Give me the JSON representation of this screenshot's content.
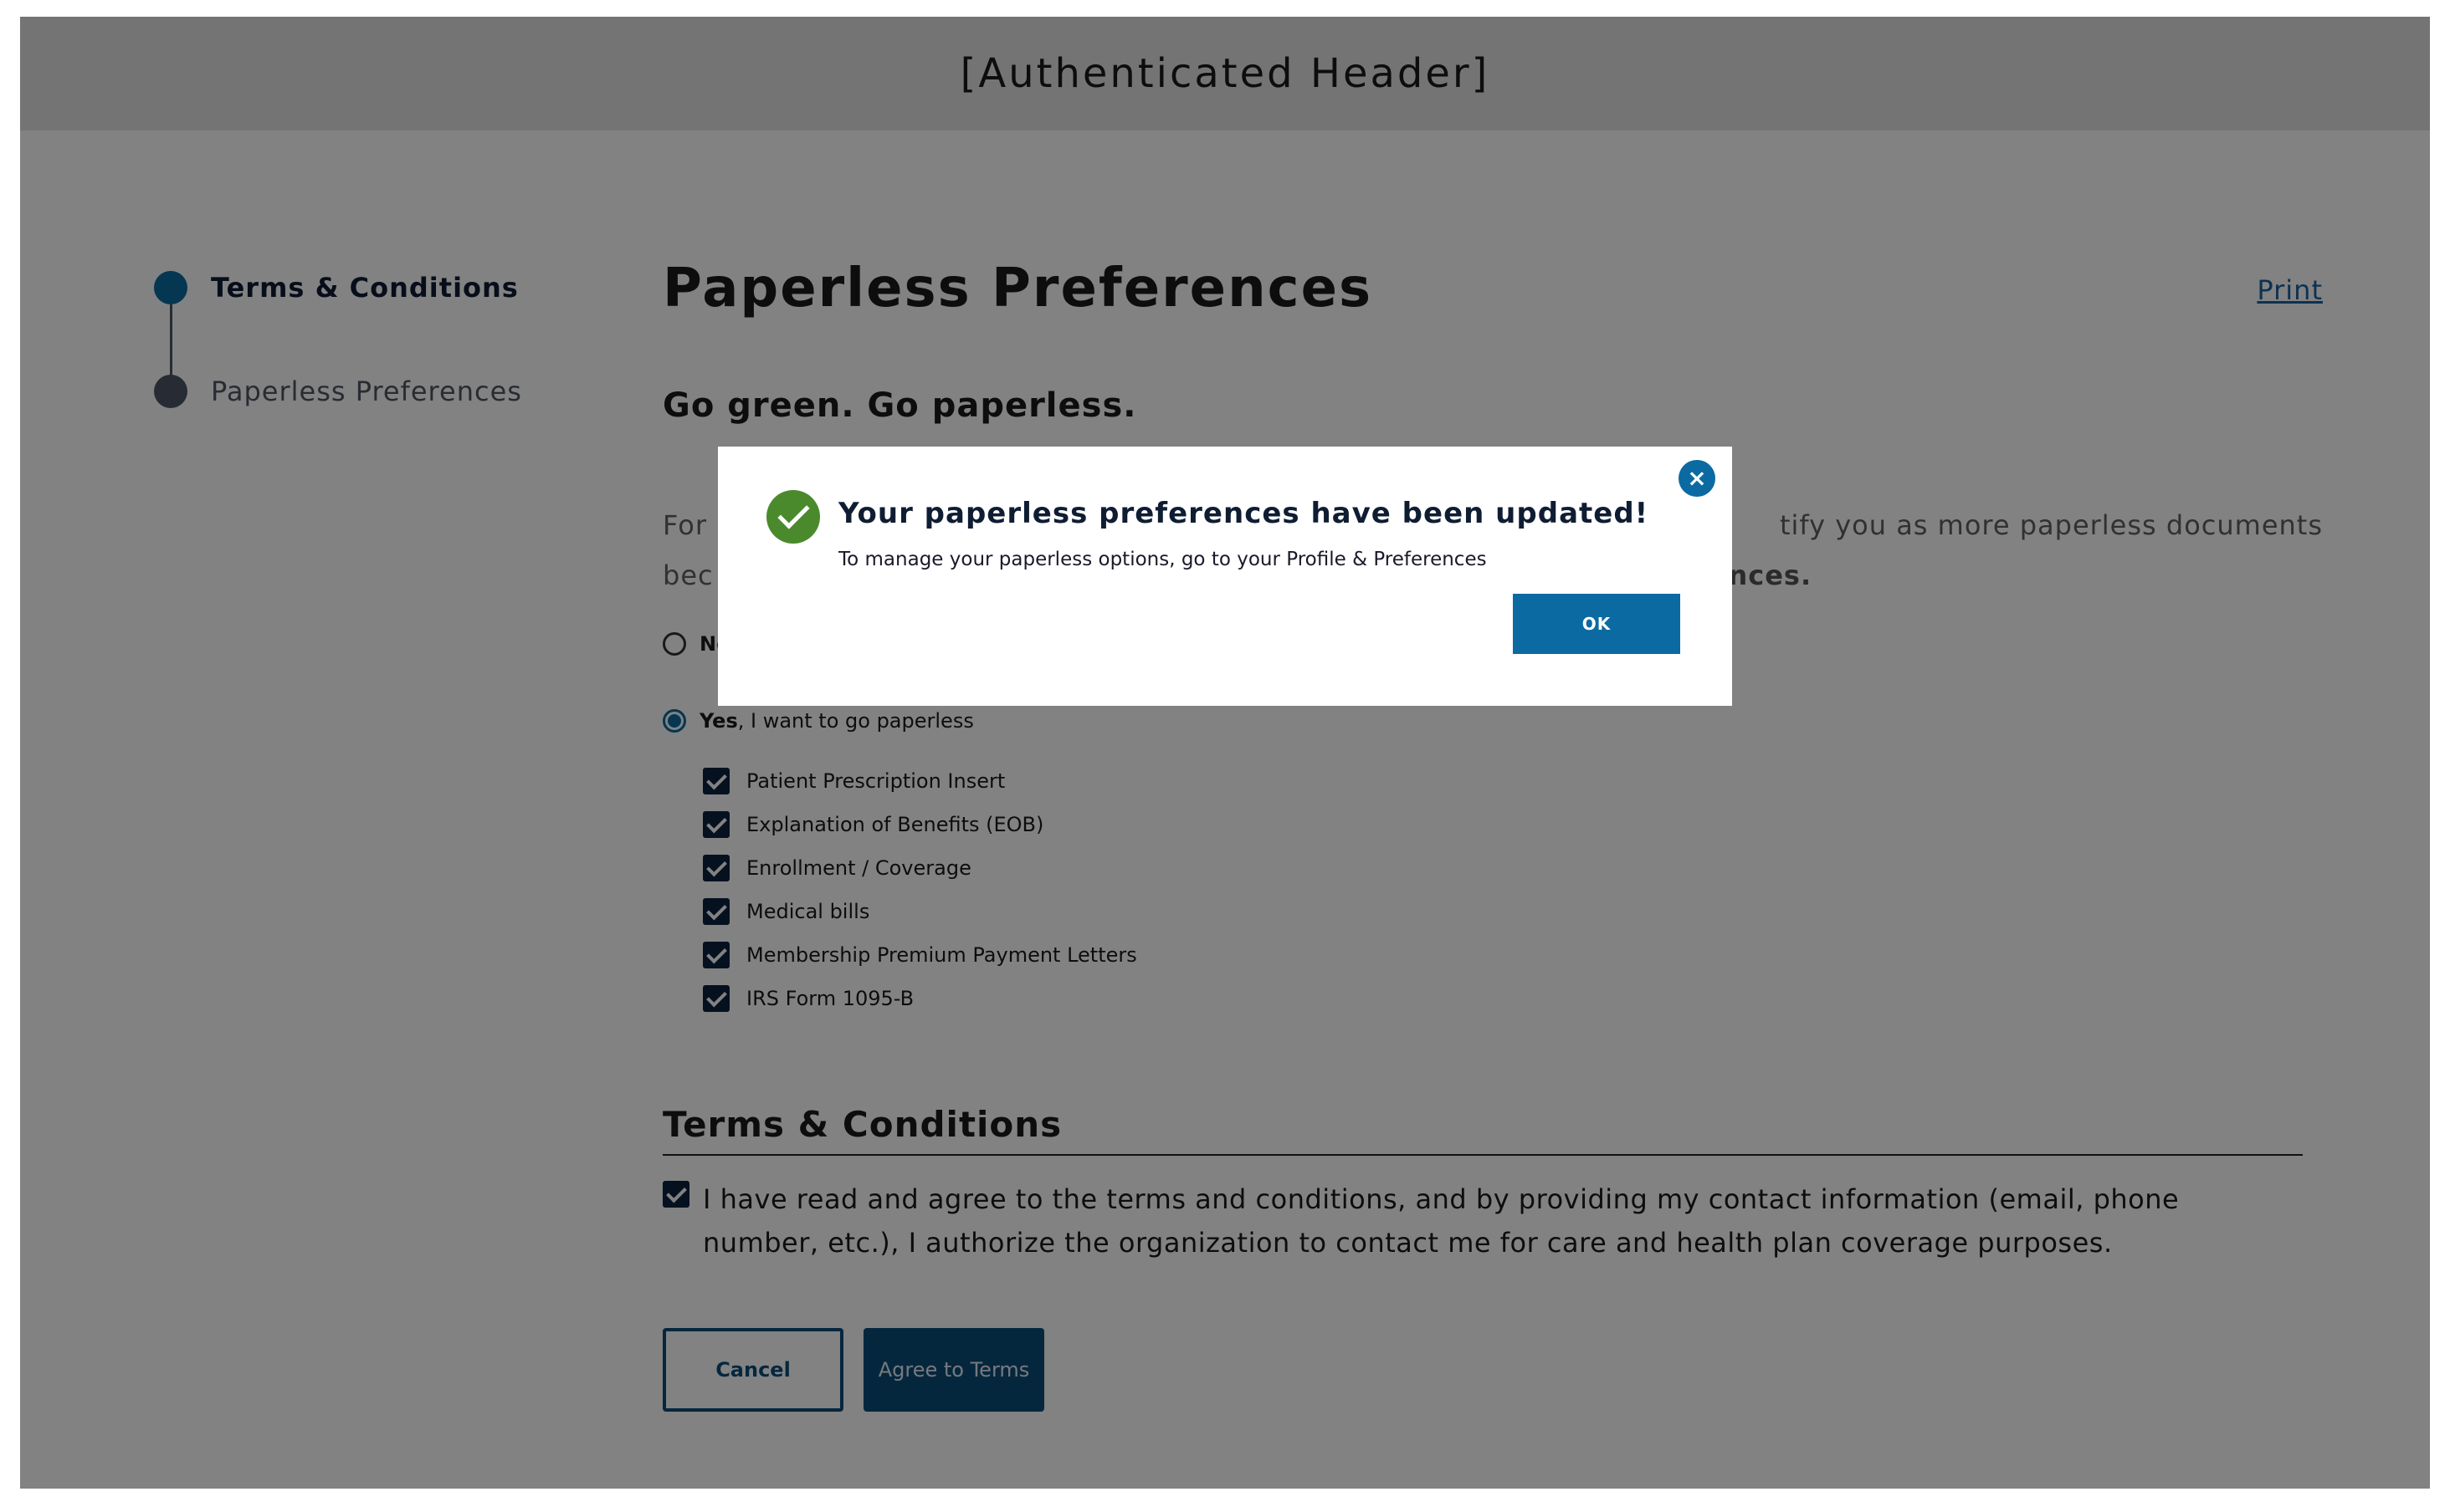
{
  "header": {
    "title": "[Authenticated Header]"
  },
  "stepper": {
    "steps": [
      {
        "label": "Terms & Conditions",
        "state": "current"
      },
      {
        "label": "Paperless Preferences",
        "state": "upcoming"
      }
    ]
  },
  "main": {
    "title": "Paperless Preferences",
    "print_label": "Print",
    "subtitle": "Go green. Go paperless.",
    "intro_left_line1": "For",
    "intro_right_line1": "tify you as more paperless documents",
    "intro_left_line2": "bec",
    "intro_right_line2": "nd Preferences.",
    "radio_no_label": "No",
    "radio_yes_bold": "Yes",
    "radio_yes_rest": ", I want to go paperless",
    "documents": [
      "Patient Prescription Insert",
      "Explanation of Benefits (EOB)",
      "Enrollment / Coverage",
      "Medical bills",
      "Membership Premium Payment Letters",
      "IRS Form 1095-B"
    ],
    "terms_heading": "Terms & Conditions",
    "terms_text": "I have read and agree to the terms and conditions, and by providing my contact information (email, phone number, etc.), I authorize the organization to contact me for care and health plan coverage purposes.",
    "cancel_label": "Cancel",
    "agree_label": "Agree to Terms"
  },
  "modal": {
    "title": "Your paperless preferences have been updated!",
    "message": "To manage your paperless options, go to your Profile & Preferences",
    "ok_label": "OK",
    "close_icon": "×"
  },
  "colors": {
    "accent": "#0a6aa1",
    "primary_dark": "#0a4d7a",
    "success": "#4a8a2c",
    "header_bg": "#e4e4e4"
  }
}
